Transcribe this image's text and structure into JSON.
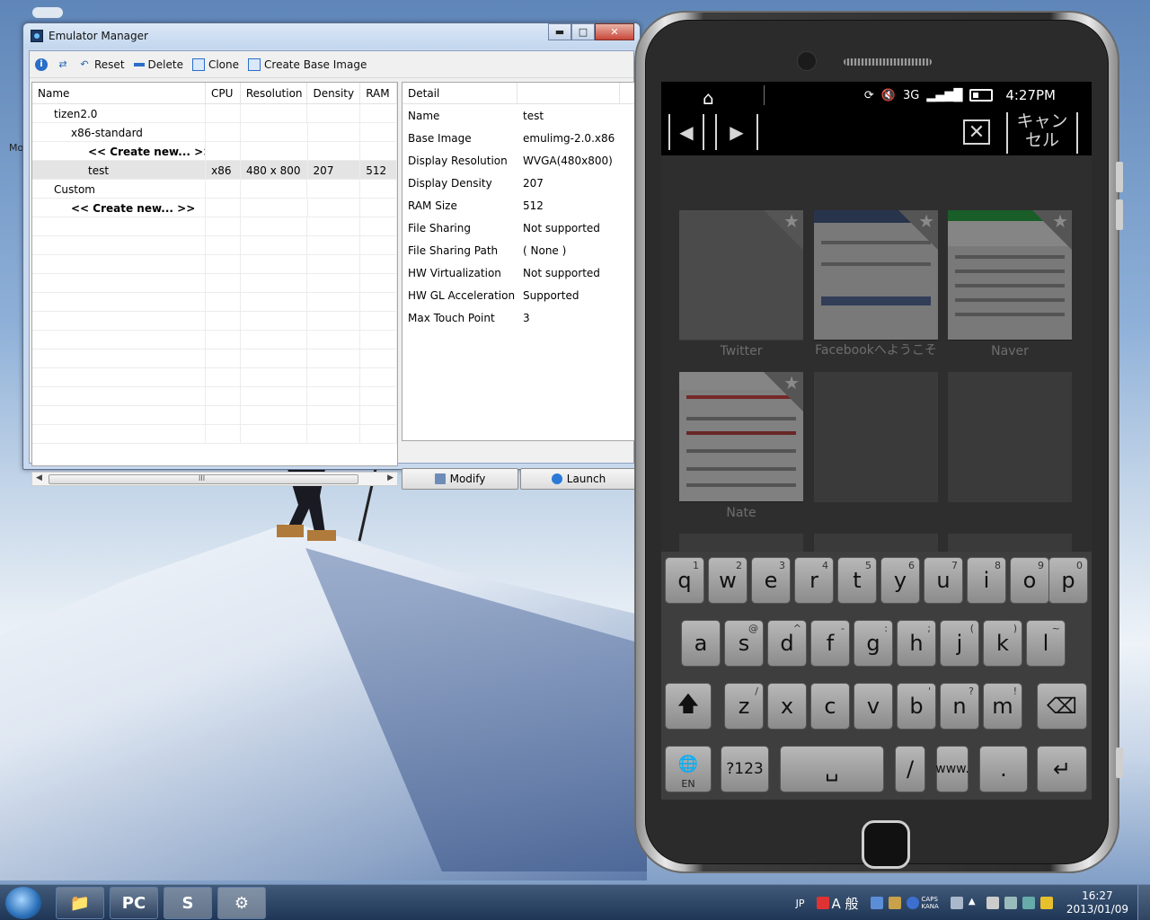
{
  "window": {
    "title": "Emulator Manager",
    "controls": {
      "minimize": "▬",
      "maximize": "□",
      "close": "✕"
    }
  },
  "toolbar": {
    "info_icon": "i",
    "refresh_icon": "⇄",
    "reset": "Reset",
    "delete": "Delete",
    "clone": "Clone",
    "create_base_image": "Create Base Image"
  },
  "tree": {
    "columns": [
      "Name",
      "CPU",
      "Resolution",
      "Density",
      "RAM"
    ],
    "rows": [
      {
        "name": "tizen2.0",
        "cpu": "",
        "res": "",
        "den": "",
        "ram": ""
      },
      {
        "name": "x86-standard",
        "cpu": "",
        "res": "",
        "den": "",
        "ram": ""
      },
      {
        "name": "<< Create new... >>",
        "cpu": "",
        "res": "",
        "den": "",
        "ram": ""
      },
      {
        "name": "test",
        "cpu": "x86",
        "res": "480 x 800",
        "den": "207",
        "ram": "512"
      },
      {
        "name": "Custom",
        "cpu": "",
        "res": "",
        "den": "",
        "ram": ""
      },
      {
        "name": "<< Create new... >>",
        "cpu": "",
        "res": "",
        "den": "",
        "ram": ""
      }
    ],
    "scroll_grip": "III"
  },
  "detail": {
    "header": "Detail",
    "rows": [
      {
        "key": "Name",
        "value": "test"
      },
      {
        "key": "Base Image",
        "value": "emulimg-2.0.x86"
      },
      {
        "key": "Display Resolution",
        "value": "WVGA(480x800)"
      },
      {
        "key": "Display Density",
        "value": "207"
      },
      {
        "key": "RAM Size",
        "value": "512"
      },
      {
        "key": "File Sharing",
        "value": "Not supported"
      },
      {
        "key": "File Sharing Path",
        "value": "( None )"
      },
      {
        "key": "HW Virtualization",
        "value": "Not supported"
      },
      {
        "key": "HW GL Acceleration",
        "value": "Supported"
      },
      {
        "key": "Max Touch Point",
        "value": "3"
      }
    ],
    "modify": "Modify",
    "launch": "Launch"
  },
  "phone": {
    "status": {
      "clock": "4:27PM",
      "network": "3G"
    },
    "nav": {
      "back": "◀",
      "forward": "▶",
      "cancel": "キャン\nセル",
      "clear_icon": "✕"
    },
    "tiles": [
      {
        "label": "Twitter"
      },
      {
        "label": "Facebookへようこそ"
      },
      {
        "label": "Naver"
      },
      {
        "label": "Nate"
      }
    ],
    "keyboard": {
      "row1": [
        {
          "k": "q",
          "h": "1"
        },
        {
          "k": "w",
          "h": "2"
        },
        {
          "k": "e",
          "h": "3"
        },
        {
          "k": "r",
          "h": "4"
        },
        {
          "k": "t",
          "h": "5"
        },
        {
          "k": "y",
          "h": "6"
        },
        {
          "k": "u",
          "h": "7"
        },
        {
          "k": "i",
          "h": "8"
        },
        {
          "k": "o",
          "h": "9"
        },
        {
          "k": "p",
          "h": "0"
        }
      ],
      "row2": [
        {
          "k": "a",
          "h": ""
        },
        {
          "k": "s",
          "h": "@"
        },
        {
          "k": "d",
          "h": "^"
        },
        {
          "k": "f",
          "h": "-"
        },
        {
          "k": "g",
          "h": ":"
        },
        {
          "k": "h",
          "h": ";"
        },
        {
          "k": "j",
          "h": "("
        },
        {
          "k": "k",
          "h": ")"
        },
        {
          "k": "l",
          "h": "~"
        }
      ],
      "row3": [
        {
          "k": "z",
          "h": "/"
        },
        {
          "k": "x",
          "h": ""
        },
        {
          "k": "c",
          "h": ""
        },
        {
          "k": "v",
          "h": ""
        },
        {
          "k": "b",
          "h": "'"
        },
        {
          "k": "n",
          "h": "?"
        },
        {
          "k": "m",
          "h": "!"
        }
      ],
      "shift": "🡅",
      "backspace": "⌫",
      "lang": "EN",
      "lang_icon": "🌐",
      "sym": "?123",
      "space": "␣",
      "slash": "/",
      "www": "www.",
      "dot": ".",
      "enter": "↵"
    }
  },
  "taskbar": {
    "apps": [
      "📁",
      "PC",
      "S",
      "⚙"
    ],
    "lang": "JP",
    "ime": "A 般",
    "caps": "CAPS\nKANA",
    "time": "16:27",
    "date": "2013/01/09"
  },
  "desktop": {
    "left_label": "Mo"
  }
}
